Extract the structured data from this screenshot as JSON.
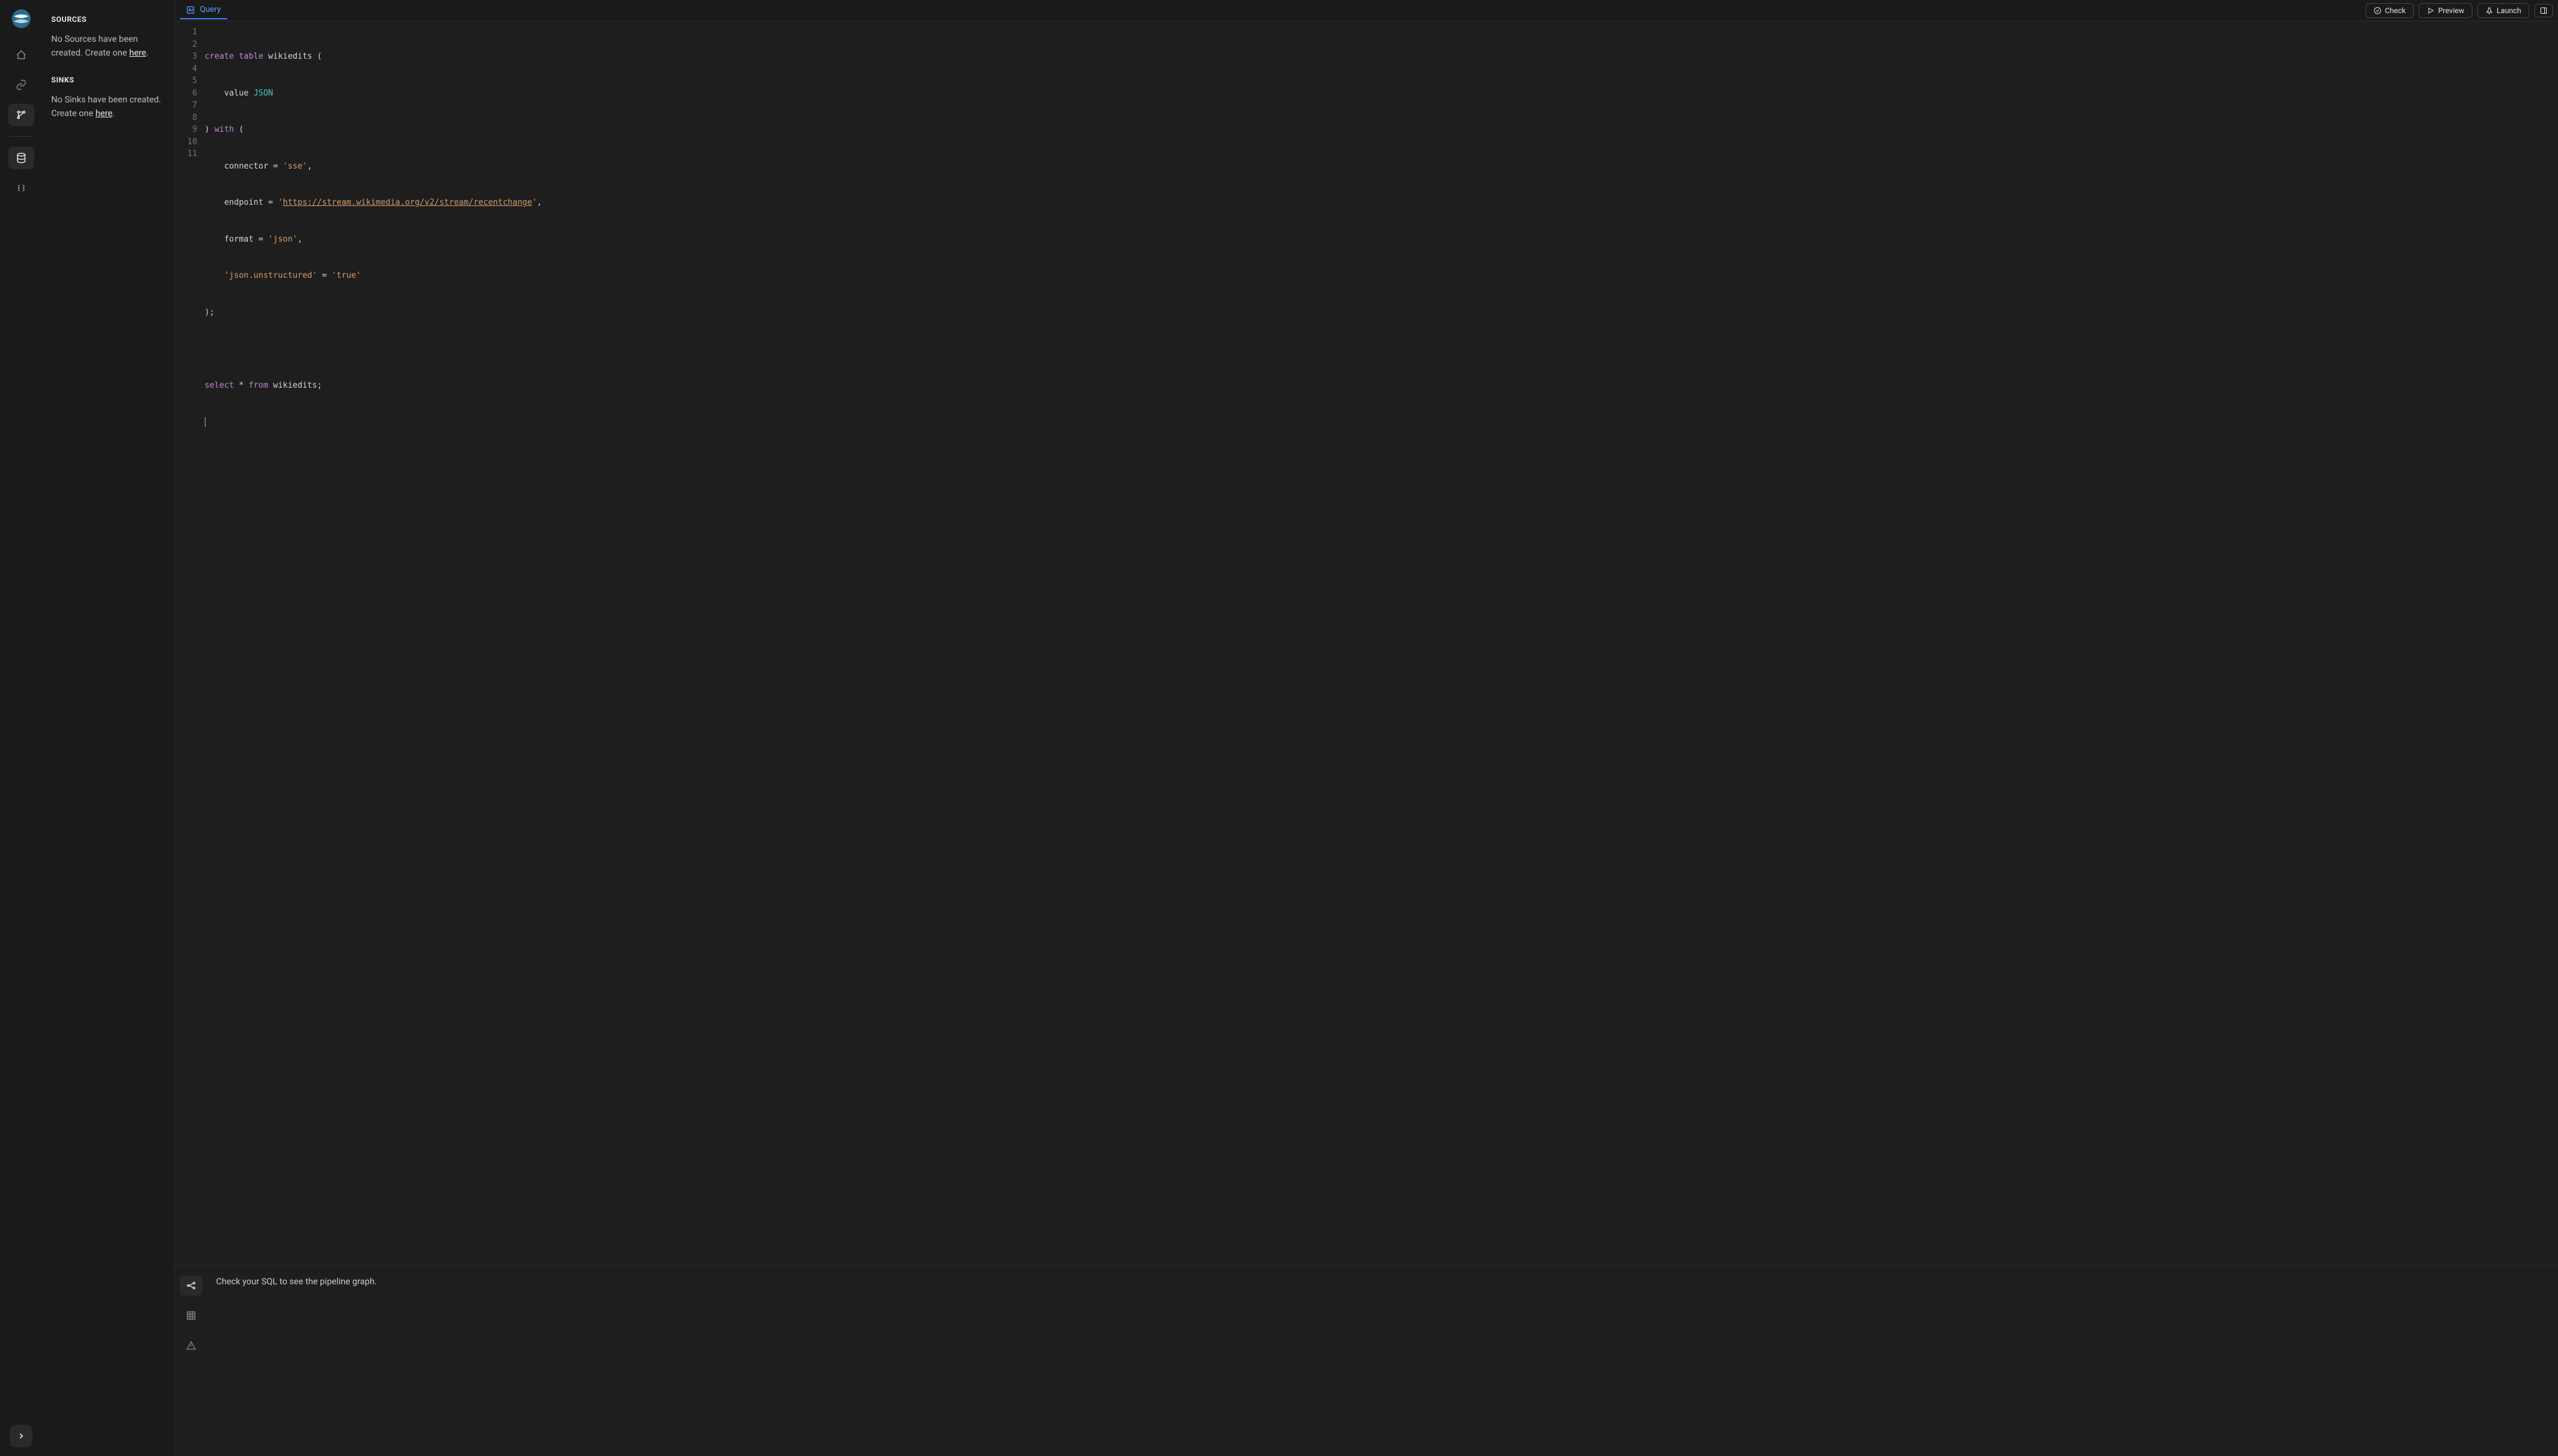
{
  "sidebar": {
    "sources": {
      "title": "SOURCES",
      "empty_prefix": "No Sources have been created. Create one ",
      "here": "here",
      "period": "."
    },
    "sinks": {
      "title": "SINKS",
      "empty_prefix": "No Sinks have been created. Create one ",
      "here": "here",
      "period": "."
    }
  },
  "tab": {
    "label": "Query"
  },
  "actions": {
    "check": "Check",
    "preview": "Preview",
    "launch": "Launch"
  },
  "editor": {
    "lines": [
      "1",
      "2",
      "3",
      "4",
      "5",
      "6",
      "7",
      "8",
      "9",
      "10",
      "11"
    ],
    "code": {
      "l1": {
        "kw1": "create",
        "kw2": "table",
        "ident": " wikiedits ",
        "p": "("
      },
      "l2": {
        "indent": "    ",
        "ident": "value ",
        "type": "JSON"
      },
      "l3": {
        "p1": ") ",
        "kw": "with",
        "p2": " ("
      },
      "l4": {
        "indent": "    ",
        "ident": "connector ",
        "eq": "= ",
        "str": "'sse'",
        "c": ","
      },
      "l5": {
        "indent": "    ",
        "ident": "endpoint ",
        "eq": "= ",
        "q1": "'",
        "url": "https://stream.wikimedia.org/v2/stream/recentchange",
        "q2": "'",
        "c": ","
      },
      "l6": {
        "indent": "    ",
        "ident": "format ",
        "eq": "= ",
        "str": "'json'",
        "c": ","
      },
      "l7": {
        "indent": "    ",
        "str1": "'json.unstructured'",
        "eq": " = ",
        "str2": "'true'"
      },
      "l8": {
        "p": ");"
      },
      "l10": {
        "kw1": "select",
        "star": " * ",
        "kw2": "from",
        "ident": " wikiedits;"
      }
    }
  },
  "panel": {
    "message": "Check your SQL to see the pipeline graph."
  }
}
